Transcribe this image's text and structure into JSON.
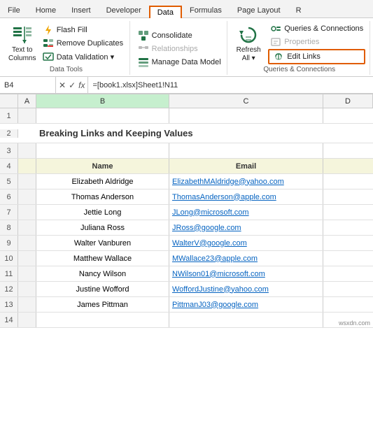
{
  "tabs": [
    "File",
    "Home",
    "Insert",
    "Developer",
    "Data",
    "Formulas",
    "Page Layout",
    "R"
  ],
  "activeTab": "Data",
  "groups": {
    "dataTools": {
      "label": "Data Tools",
      "buttons": {
        "textToColumns": "Text to\nColumns",
        "flashFill": "Flash Fill",
        "removeDuplicates": "Remove Duplicates",
        "dataValidation": "Data Validation",
        "consolidate": "Consolidate",
        "relationships": "Relationships",
        "manageDataModel": "Manage Data Model"
      }
    },
    "queriesConnections": {
      "label": "Queries & Connections",
      "refreshAll": "Refresh\nAll",
      "queriesConnections": "Queries & Connections",
      "properties": "Properties",
      "editLinks": "Edit Links"
    }
  },
  "formulaBar": {
    "cellRef": "B4",
    "formula": "=[book1.xlsx]Sheet1!N11"
  },
  "spreadsheet": {
    "title": "Breaking Links and Keeping Values",
    "columns": {
      "b": "Name",
      "c": "Email"
    },
    "rows": [
      {
        "row": 1,
        "name": "",
        "email": ""
      },
      {
        "row": 2,
        "name": "",
        "email": ""
      },
      {
        "row": 3,
        "name": "",
        "email": ""
      },
      {
        "row": 4,
        "name": "Name",
        "email": "Email",
        "isHeader": true
      },
      {
        "row": 5,
        "name": "Elizabeth Aldridge",
        "email": "ElizabethMAldridge@yahoo.com"
      },
      {
        "row": 6,
        "name": "Thomas Anderson",
        "email": "ThomasAnderson@apple.com"
      },
      {
        "row": 7,
        "name": "Jettie Long",
        "email": "JLong@microsoft.com"
      },
      {
        "row": 8,
        "name": "Juliana Ross",
        "email": "JRoss@google.com"
      },
      {
        "row": 9,
        "name": "Walter Vanburen",
        "email": "WalterV@google.com"
      },
      {
        "row": 10,
        "name": "Matthew Wallace",
        "email": "MWallace23@apple.com"
      },
      {
        "row": 11,
        "name": "Nancy Wilson",
        "email": "NWilson01@microsoft.com"
      },
      {
        "row": 12,
        "name": "Justine Wofford",
        "email": "WoffordJustine@yahoo.com"
      },
      {
        "row": 13,
        "name": "James Pittman",
        "email": "PittmanJ03@google.com"
      },
      {
        "row": 14,
        "name": "",
        "email": ""
      }
    ]
  },
  "watermark": "wsxdn.com"
}
